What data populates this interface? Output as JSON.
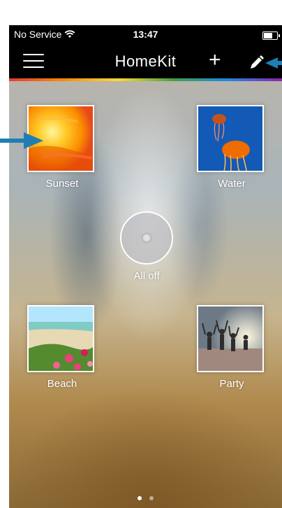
{
  "status": {
    "carrier": "No Service",
    "time": "13:47"
  },
  "nav": {
    "title": "HomeKit"
  },
  "scenes": [
    {
      "label": "Sunset"
    },
    {
      "label": "Water"
    },
    {
      "label": "Beach"
    },
    {
      "label": "Party"
    }
  ],
  "all_off": {
    "label": "All off"
  },
  "page_indicator": {
    "current": 1,
    "total": 2
  },
  "colors": {
    "annotation_arrow": "#1f7fb4"
  }
}
